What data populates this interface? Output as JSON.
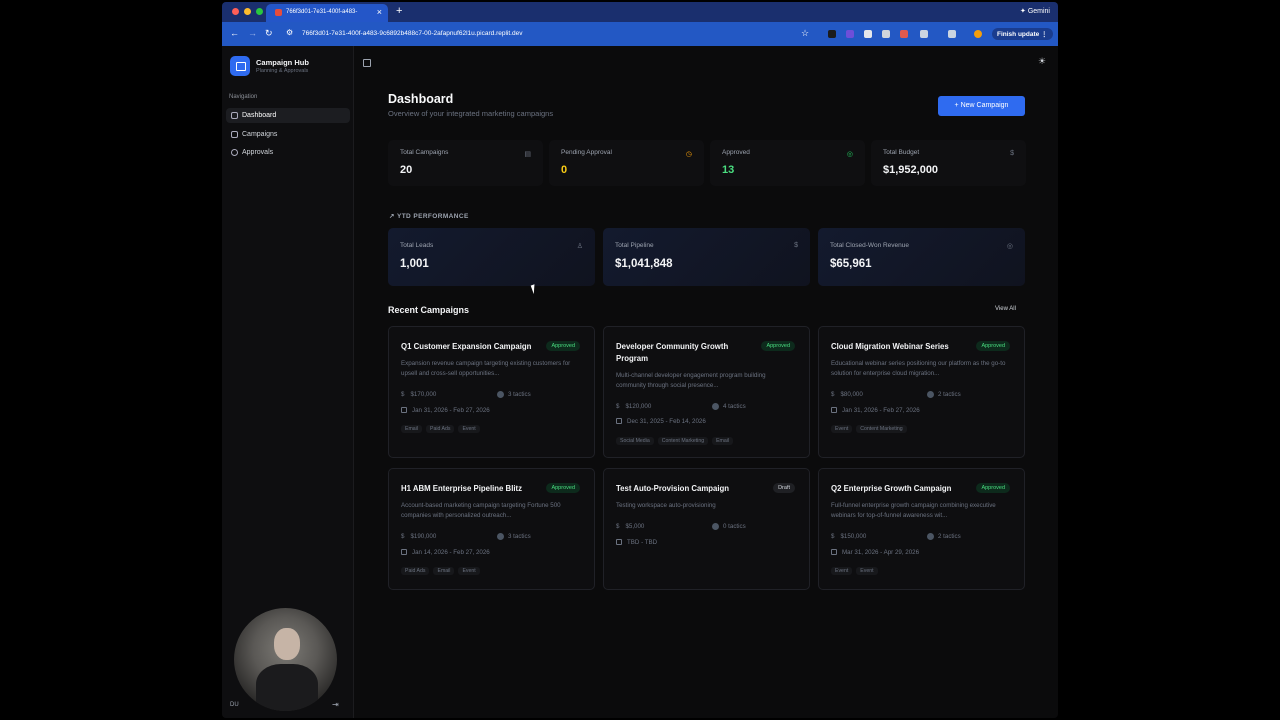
{
  "browser": {
    "tab_title": "766f3d01-7e31-400f-a483-",
    "url": "766f3d01-7e31-400f-a483-9c6892b488c7-00-2afapnuf62l1u.picard.replit.dev",
    "gemini_label": "Gemini",
    "finish_update_label": "Finish update"
  },
  "sidebar": {
    "brand_title": "Campaign Hub",
    "brand_subtitle": "Planning & Approvals",
    "nav_label": "Navigation",
    "items": [
      {
        "label": "Dashboard",
        "active": true
      },
      {
        "label": "Campaigns",
        "active": false
      },
      {
        "label": "Approvals",
        "active": false
      }
    ],
    "user_initials": "DU"
  },
  "header": {
    "title": "Dashboard",
    "subtitle": "Overview of your integrated marketing campaigns",
    "new_button": "+  New Campaign"
  },
  "stats": [
    {
      "label": "Total Campaigns",
      "value": "20",
      "color": "#f3f4f6",
      "icon": "document-icon"
    },
    {
      "label": "Pending Approval",
      "value": "0",
      "color": "#facc15",
      "icon": "clock-icon"
    },
    {
      "label": "Approved",
      "value": "13",
      "color": "#4ade80",
      "icon": "check-circle-icon"
    },
    {
      "label": "Total Budget",
      "value": "$1,952,000",
      "color": "#f3f4f6",
      "icon": "dollar-icon"
    }
  ],
  "ytd": {
    "label": "YTD PERFORMANCE",
    "items": [
      {
        "label": "Total Leads",
        "value": "1,001"
      },
      {
        "label": "Total Pipeline",
        "value": "$1,041,848"
      },
      {
        "label": "Total Closed-Won Revenue",
        "value": "$65,961"
      }
    ]
  },
  "recent": {
    "title": "Recent Campaigns",
    "view_all": "View All",
    "campaigns": [
      {
        "title": "Q1 Customer Expansion Campaign",
        "status": "Approved",
        "desc": "Expansion revenue campaign targeting existing customers for upsell and cross-sell opportunities...",
        "budget": "$170,000",
        "tactics": "3 tactics",
        "dates": "Jan 31, 2026 - Feb 27, 2026",
        "tags": [
          "Email",
          "Paid Ads",
          "Event"
        ]
      },
      {
        "title": "Developer Community Growth Program",
        "status": "Approved",
        "desc": "Multi-channel developer engagement program building community through social presence...",
        "budget": "$120,000",
        "tactics": "4 tactics",
        "dates": "Dec 31, 2025 - Feb 14, 2026",
        "tags": [
          "Social Media",
          "Content Marketing",
          "Email"
        ]
      },
      {
        "title": "Cloud Migration Webinar Series",
        "status": "Approved",
        "desc": "Educational webinar series positioning our platform as the go-to solution for enterprise cloud migration...",
        "budget": "$80,000",
        "tactics": "2 tactics",
        "dates": "Jan 31, 2026 - Feb 27, 2026",
        "tags": [
          "Event",
          "Content Marketing"
        ]
      },
      {
        "title": "H1 ABM Enterprise Pipeline Blitz",
        "status": "Approved",
        "desc": "Account-based marketing campaign targeting Fortune 500 companies with personalized outreach...",
        "budget": "$190,000",
        "tactics": "3 tactics",
        "dates": "Jan 14, 2026 - Feb 27, 2026",
        "tags": [
          "Paid Ads",
          "Email",
          "Event"
        ]
      },
      {
        "title": "Test Auto-Provision Campaign",
        "status": "Draft",
        "desc": "Testing workspace auto-provisioning",
        "budget": "$5,000",
        "tactics": "0 tactics",
        "dates": "TBD - TBD",
        "tags": []
      },
      {
        "title": "Q2 Enterprise Growth Campaign",
        "status": "Approved",
        "desc": "Full-funnel enterprise growth campaign combining executive webinars for top-of-funnel awareness wit...",
        "budget": "$150,000",
        "tactics": "2 tactics",
        "dates": "Mar 31, 2026 - Apr 29, 2026",
        "tags": [
          "Event",
          "Event"
        ]
      }
    ]
  }
}
